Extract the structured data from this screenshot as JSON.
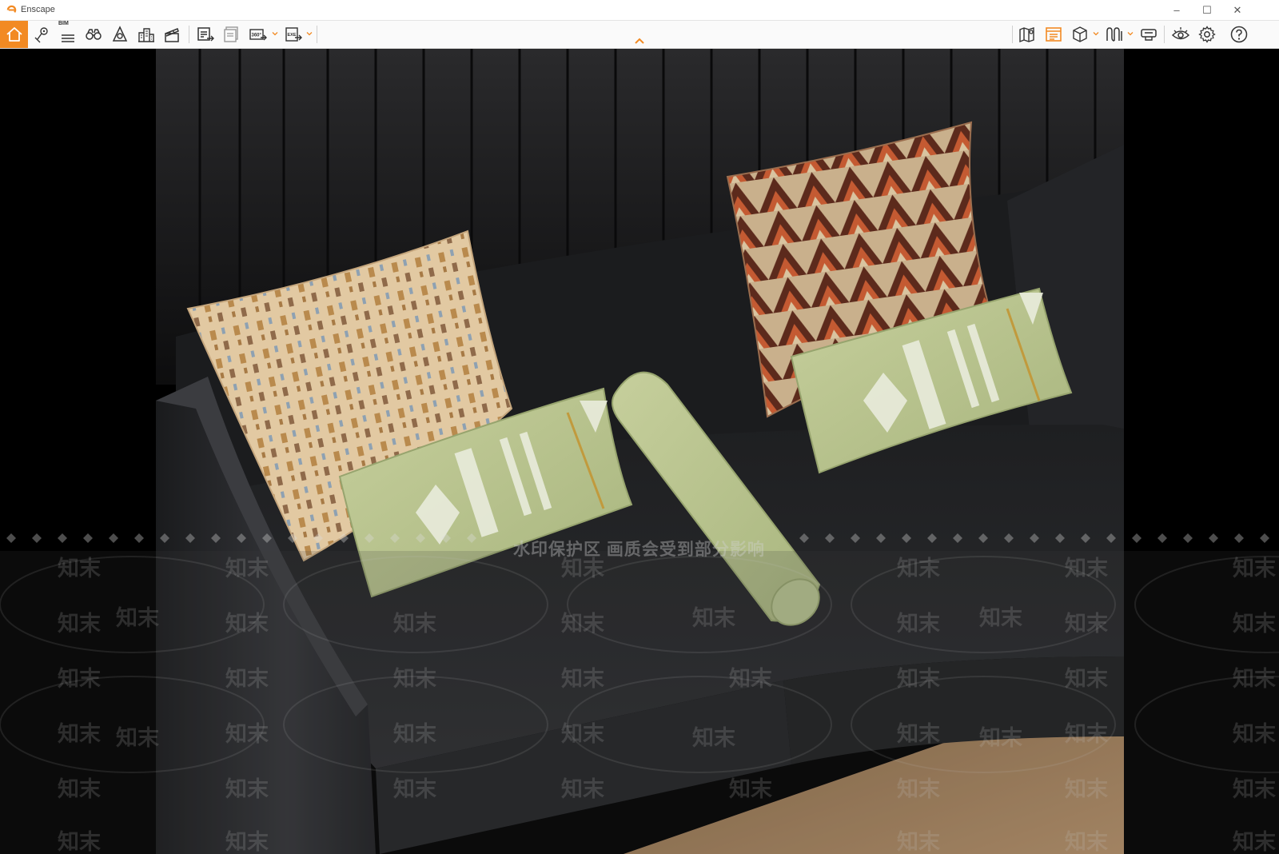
{
  "window": {
    "title": "Enscape",
    "minimize_glyph": "–",
    "maximize_glyph": "☐",
    "close_glyph": "✕"
  },
  "toolbar": {
    "left_tools": [
      {
        "name": "home-icon",
        "active": true
      },
      {
        "name": "location-pin-icon"
      },
      {
        "name": "bim-icon",
        "label": "BIM"
      },
      {
        "name": "binoculars-icon"
      },
      {
        "name": "light-view-icon"
      },
      {
        "name": "buildings-icon"
      },
      {
        "name": "clapperboard-icon"
      },
      {
        "name": "screenshot-export-icon"
      },
      {
        "name": "batch-export-icon"
      },
      {
        "name": "panorama-icon",
        "label": "360°",
        "has_dropdown": true
      },
      {
        "name": "exe-export-icon",
        "label": "EXE",
        "has_dropdown": true
      }
    ],
    "right_tools": [
      {
        "name": "map-icon"
      },
      {
        "name": "asset-library-icon",
        "active": true
      },
      {
        "name": "cube-view-icon",
        "has_dropdown": true
      },
      {
        "name": "material-editor-icon",
        "has_dropdown": true
      },
      {
        "name": "vr-headset-icon"
      },
      {
        "name": "visual-settings-icon"
      },
      {
        "name": "settings-gear-icon"
      },
      {
        "name": "help-icon"
      }
    ],
    "accent_color": "#f28a23"
  },
  "viewport": {
    "watermark_text": "水印保护区 画质会受到部分影响",
    "watermark_brand": "知末",
    "scene": "dark leather sofa with patterned cushions"
  }
}
